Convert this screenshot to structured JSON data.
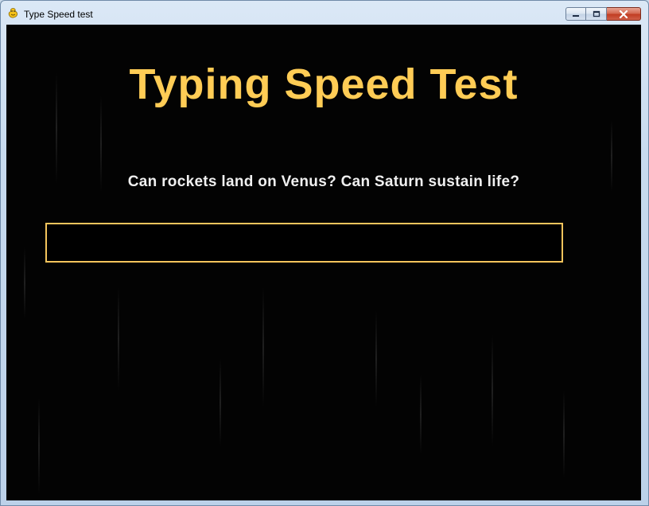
{
  "window": {
    "title": "Type Speed test",
    "app_icon": "pygame-snake-icon",
    "controls": {
      "minimize_icon": "minimize-icon",
      "maximize_icon": "maximize-icon",
      "close_icon": "close-icon"
    }
  },
  "app": {
    "heading": "Typing Speed Test",
    "sentence": "Can rockets land on Venus? Can Saturn sustain life?",
    "input_value": ""
  },
  "colors": {
    "background": "#030303",
    "heading": "#ffcc55",
    "sentence": "#f0f0f0",
    "input_border": "#f4c45c"
  }
}
